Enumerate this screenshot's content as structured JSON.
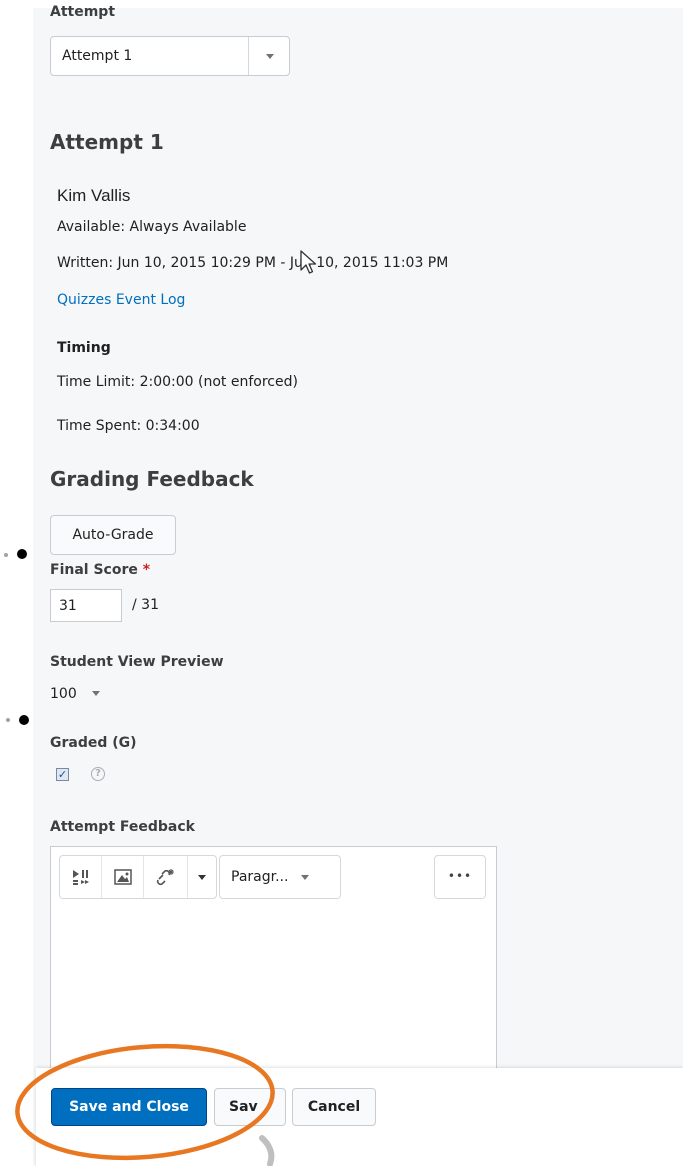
{
  "attempt_select": {
    "label": "Attempt",
    "value": "Attempt 1"
  },
  "attempt": {
    "heading": "Attempt 1",
    "student_name": "Kim Vallis",
    "availability": "Available: Always Available",
    "written": "Written: Jun 10, 2015 10:29 PM - Jun 10, 2015 11:03 PM",
    "event_log_link": "Quizzes Event Log"
  },
  "timing": {
    "heading": "Timing",
    "time_limit": "Time Limit: 2:00:00 (not enforced)",
    "time_spent": "Time Spent: 0:34:00"
  },
  "grading": {
    "heading": "Grading Feedback",
    "auto_grade_label": "Auto-Grade",
    "final_score_label": "Final Score",
    "required_marker": "*",
    "score_value": "31",
    "score_total": "/ 31",
    "student_view_label": "Student View Preview",
    "student_view_value": "100",
    "graded_label": "Graded (G)",
    "graded_checked": true,
    "attempt_feedback_label": "Attempt Feedback"
  },
  "editor": {
    "format_value": "Paragr...",
    "more_label": "•••"
  },
  "actions": {
    "save_close": "Save and Close",
    "save": "Sav",
    "cancel": "Cancel"
  },
  "colors": {
    "accent": "#006fbf",
    "required": "#cd2026",
    "highlight_circle": "#e87722"
  },
  "icons": [
    "chevron-down-icon",
    "media-icon",
    "image-icon",
    "link-icon",
    "help-icon",
    "checkbox-checked-icon",
    "mouse-cursor-icon"
  ]
}
